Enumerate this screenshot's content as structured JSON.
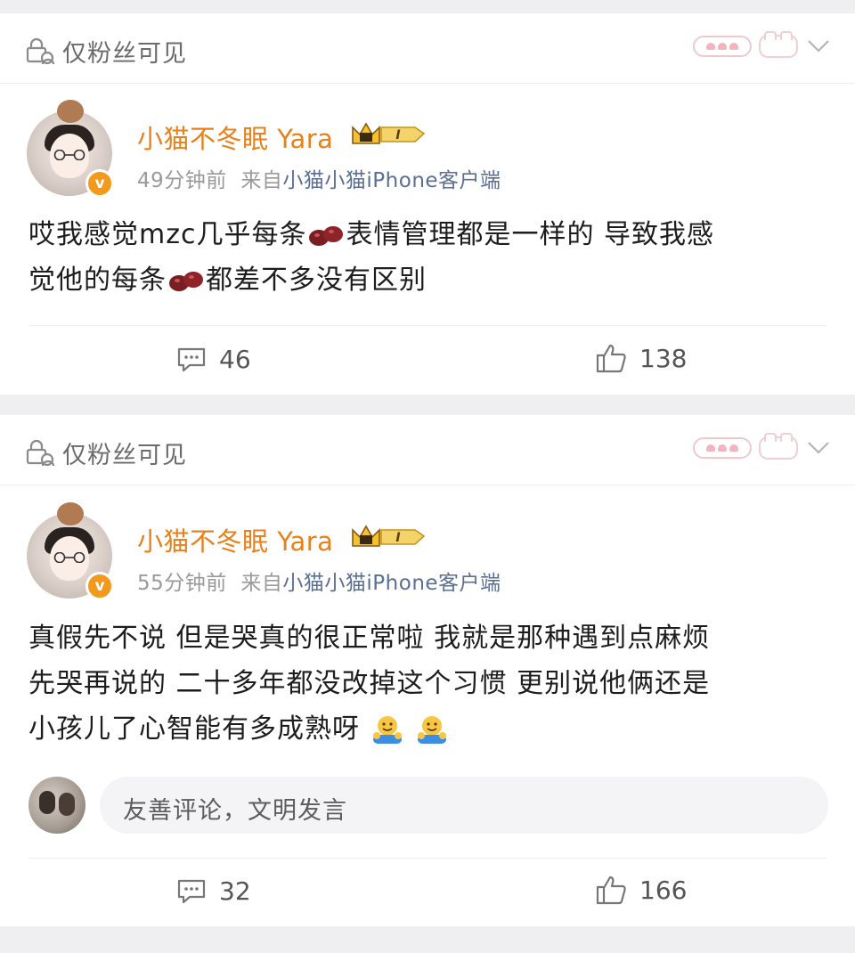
{
  "posts": [
    {
      "visibility": "仅粉丝可见",
      "user": {
        "name": "小猫不冬眠 Yara",
        "level_badge": "I",
        "verified_badge": "v"
      },
      "time": "49分钟前",
      "source_prefix": "来自",
      "source": "小猫小猫iPhone客户端",
      "content": {
        "line1_a": "哎我感觉mzc几乎每条",
        "line1_b": "表情管理都是一样的  导致我感",
        "line2_a": "觉他的每条",
        "line2_b": "都差不多没有区别"
      },
      "comments": "46",
      "likes": "138"
    },
    {
      "visibility": "仅粉丝可见",
      "user": {
        "name": "小猫不冬眠 Yara",
        "level_badge": "I",
        "verified_badge": "v"
      },
      "time": "55分钟前",
      "source_prefix": "来自",
      "source": "小猫小猫iPhone客户端",
      "content": {
        "line1": "真假先不说  但是哭真的很正常啦  我就是那种遇到点麻烦",
        "line2": "先哭再说的  二十多年都没改掉这个习惯  更别说他俩还是",
        "line3": "小孩儿了心智能有多成熟呀"
      },
      "comment_placeholder": "友善评论，文明发言",
      "comments": "32",
      "likes": "166"
    }
  ],
  "icons": {
    "lock": "lock-visibility-icon",
    "chevron": "chevron-down-icon",
    "comment": "comment-icon",
    "like": "thumbs-up-icon",
    "bean": "bean-emoji-icon",
    "hug": "hug-emoji-icon"
  },
  "colors": {
    "username": "#e8811b",
    "source": "#5b6f95",
    "meta": "#9a9a9a",
    "background": "#efeff1"
  }
}
